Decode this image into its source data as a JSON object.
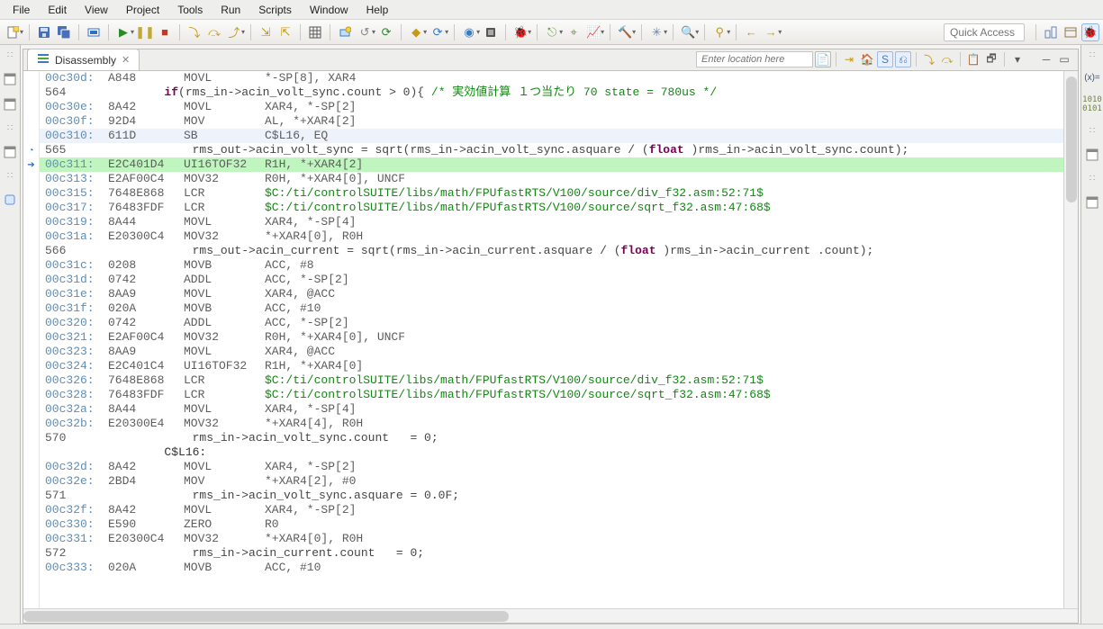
{
  "menu": [
    "File",
    "Edit",
    "View",
    "Project",
    "Tools",
    "Run",
    "Scripts",
    "Window",
    "Help"
  ],
  "quick_access_placeholder": "Quick Access",
  "tab": {
    "title": "Disassembly",
    "location_placeholder": "Enter location here"
  },
  "lines": [
    {
      "k": "asm",
      "addr": "00c30d:",
      "hex": "A848",
      "mnem": "MOVL",
      "oper": "*-SP[8], XAR4"
    },
    {
      "k": "src",
      "line": "564",
      "text_prefix": "        if(rms_in->acin_volt_sync.count > 0){ ",
      "comment": "/* 実効値計算 １つ当たり 70 state = 780us */",
      "kw": "if"
    },
    {
      "k": "asm",
      "addr": "00c30e:",
      "hex": "8A42",
      "mnem": "MOVL",
      "oper": "XAR4, *-SP[2]"
    },
    {
      "k": "asm",
      "addr": "00c30f:",
      "hex": "92D4",
      "mnem": "MOV",
      "oper": "AL, *+XAR4[2]"
    },
    {
      "k": "asm",
      "addr": "00c310:",
      "hex": "611D",
      "mnem": "SB",
      "oper": "C$L16, EQ",
      "cls": "hl-blue"
    },
    {
      "k": "src",
      "line": "565",
      "marker": "blue",
      "text": "            rms_out->acin_volt_sync = sqrt(rms_in->acin_volt_sync.asquare / (",
      "kw": "float",
      "text2": " )rms_in->acin_volt_sync.count);"
    },
    {
      "k": "asm",
      "addr": "00c311:",
      "hex": "E2C401D4",
      "mnem": "UI16TOF32",
      "oper": "R1H, *+XAR4[2]",
      "cls": "hl-green",
      "marker": "arrow"
    },
    {
      "k": "asm",
      "addr": "00c313:",
      "hex": "E2AF00C4",
      "mnem": "MOV32",
      "oper": "R0H, *+XAR4[0], UNCF"
    },
    {
      "k": "asm",
      "addr": "00c315:",
      "hex": "7648E868",
      "mnem": "LCR",
      "path": "$C:/ti/controlSUITE/libs/math/FPUfastRTS/V100/source/div_f32.asm:52:71$"
    },
    {
      "k": "asm",
      "addr": "00c317:",
      "hex": "76483FDF",
      "mnem": "LCR",
      "path": "$C:/ti/controlSUITE/libs/math/FPUfastRTS/V100/source/sqrt_f32.asm:47:68$"
    },
    {
      "k": "asm",
      "addr": "00c319:",
      "hex": "8A44",
      "mnem": "MOVL",
      "oper": "XAR4, *-SP[4]"
    },
    {
      "k": "asm",
      "addr": "00c31a:",
      "hex": "E20300C4",
      "mnem": "MOV32",
      "oper": "*+XAR4[0], R0H"
    },
    {
      "k": "src",
      "line": "566",
      "text": "            rms_out->acin_current = sqrt(rms_in->acin_current.asquare / (",
      "kw": "float",
      "text2": " )rms_in->acin_current .count);"
    },
    {
      "k": "asm",
      "addr": "00c31c:",
      "hex": "0208",
      "mnem": "MOVB",
      "oper": "ACC, #8"
    },
    {
      "k": "asm",
      "addr": "00c31d:",
      "hex": "0742",
      "mnem": "ADDL",
      "oper": "ACC, *-SP[2]"
    },
    {
      "k": "asm",
      "addr": "00c31e:",
      "hex": "8AA9",
      "mnem": "MOVL",
      "oper": "XAR4, @ACC"
    },
    {
      "k": "asm",
      "addr": "00c31f:",
      "hex": "020A",
      "mnem": "MOVB",
      "oper": "ACC, #10"
    },
    {
      "k": "asm",
      "addr": "00c320:",
      "hex": "0742",
      "mnem": "ADDL",
      "oper": "ACC, *-SP[2]"
    },
    {
      "k": "asm",
      "addr": "00c321:",
      "hex": "E2AF00C4",
      "mnem": "MOV32",
      "oper": "R0H, *+XAR4[0], UNCF"
    },
    {
      "k": "asm",
      "addr": "00c323:",
      "hex": "8AA9",
      "mnem": "MOVL",
      "oper": "XAR4, @ACC"
    },
    {
      "k": "asm",
      "addr": "00c324:",
      "hex": "E2C401C4",
      "mnem": "UI16TOF32",
      "oper": "R1H, *+XAR4[0]"
    },
    {
      "k": "asm",
      "addr": "00c326:",
      "hex": "7648E868",
      "mnem": "LCR",
      "path": "$C:/ti/controlSUITE/libs/math/FPUfastRTS/V100/source/div_f32.asm:52:71$"
    },
    {
      "k": "asm",
      "addr": "00c328:",
      "hex": "76483FDF",
      "mnem": "LCR",
      "path": "$C:/ti/controlSUITE/libs/math/FPUfastRTS/V100/source/sqrt_f32.asm:47:68$"
    },
    {
      "k": "asm",
      "addr": "00c32a:",
      "hex": "8A44",
      "mnem": "MOVL",
      "oper": "XAR4, *-SP[4]"
    },
    {
      "k": "asm",
      "addr": "00c32b:",
      "hex": "E20300E4",
      "mnem": "MOV32",
      "oper": "*+XAR4[4], R0H"
    },
    {
      "k": "src",
      "line": "570",
      "text": "            rms_in->acin_volt_sync.count   = 0;"
    },
    {
      "k": "label",
      "text": "        C$L16:"
    },
    {
      "k": "asm",
      "addr": "00c32d:",
      "hex": "8A42",
      "mnem": "MOVL",
      "oper": "XAR4, *-SP[2]"
    },
    {
      "k": "asm",
      "addr": "00c32e:",
      "hex": "2BD4",
      "mnem": "MOV",
      "oper": "*+XAR4[2], #0"
    },
    {
      "k": "src",
      "line": "571",
      "text": "            rms_in->acin_volt_sync.asquare = 0.0F;"
    },
    {
      "k": "asm",
      "addr": "00c32f:",
      "hex": "8A42",
      "mnem": "MOVL",
      "oper": "XAR4, *-SP[2]"
    },
    {
      "k": "asm",
      "addr": "00c330:",
      "hex": "E590",
      "mnem": "ZERO",
      "oper": "R0"
    },
    {
      "k": "asm",
      "addr": "00c331:",
      "hex": "E20300C4",
      "mnem": "MOV32",
      "oper": "*+XAR4[0], R0H"
    },
    {
      "k": "src",
      "line": "572",
      "text": "            rms_in->acin_current.count   = 0;"
    },
    {
      "k": "asm",
      "addr": "00c333:",
      "hex": "020A",
      "mnem": "MOVB",
      "oper": "ACC, #10"
    }
  ]
}
